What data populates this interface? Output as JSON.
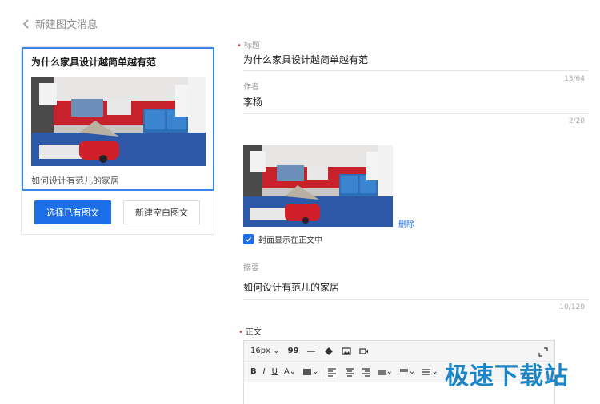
{
  "header": {
    "back_label": "新建图文消息"
  },
  "card": {
    "title": "为什么家具设计越简单越有范",
    "digest": "如何设计有范儿的家居",
    "select_existing_label": "选择已有图文",
    "new_blank_label": "新建空白图文"
  },
  "form": {
    "title_label": "标题",
    "title_value": "为什么家具设计越简单越有范",
    "title_count": "13/64",
    "author_label": "作者",
    "author_value": "李杨",
    "author_count": "2/20",
    "delete_label": "删除",
    "show_cover_label": "封面显示在正文中",
    "show_cover_checked": true,
    "summary_label": "摘要",
    "summary_value": "如何设计有范儿的家居",
    "summary_count": "10/120",
    "body_label": "正文"
  },
  "editor": {
    "font_size": "16px",
    "quote_glyph": "99"
  },
  "watermark": "极速下载站",
  "colors": {
    "primary": "#1b6ee8",
    "required": "#e64340",
    "selected_border": "#3a85e8"
  }
}
